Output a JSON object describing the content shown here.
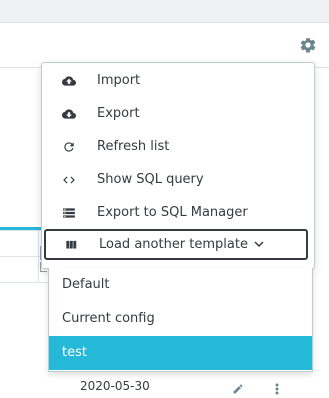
{
  "colors": {
    "accent": "#25b9d7",
    "text": "#363a41",
    "border": "#bbcdd2"
  },
  "toolbar": {
    "settings_icon": "gear-icon"
  },
  "menu": {
    "items": [
      {
        "icon": "cloud-upload-icon",
        "label": "Import"
      },
      {
        "icon": "cloud-download-icon",
        "label": "Export"
      },
      {
        "icon": "refresh-icon",
        "label": "Refresh list"
      },
      {
        "icon": "code-icon",
        "label": "Show SQL query"
      },
      {
        "icon": "storage-icon",
        "label": "Export to SQL Manager"
      },
      {
        "icon": "view-column-icon",
        "label": "Load another template",
        "expanded": true
      }
    ]
  },
  "submenu": {
    "items": [
      {
        "label": "Default",
        "selected": false
      },
      {
        "label": "Current config",
        "selected": false
      },
      {
        "label": "test",
        "selected": true
      }
    ]
  },
  "background": {
    "date": "2020-05-30"
  }
}
